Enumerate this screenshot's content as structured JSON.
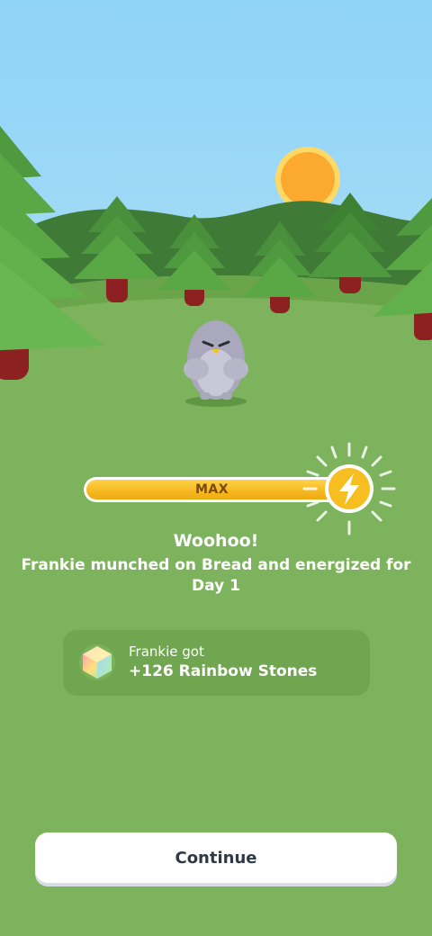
{
  "energy": {
    "label": "MAX",
    "level": 1.0,
    "icon": "lightning-bolt-icon"
  },
  "message": {
    "headline": "Woohoo!",
    "subline": "Frankie munched on Bread and energized for Day 1"
  },
  "reward": {
    "title": "Frankie got",
    "value": "+126 Rainbow Stones",
    "icon": "rainbow-stone-icon"
  },
  "continue_label": "Continue",
  "colors": {
    "sky": "#9dd8f6",
    "grass": "#7db35c",
    "energy_fill": "#f6b81f",
    "bolt_badge": "#f7be22",
    "sun": "#fbaa2f"
  }
}
